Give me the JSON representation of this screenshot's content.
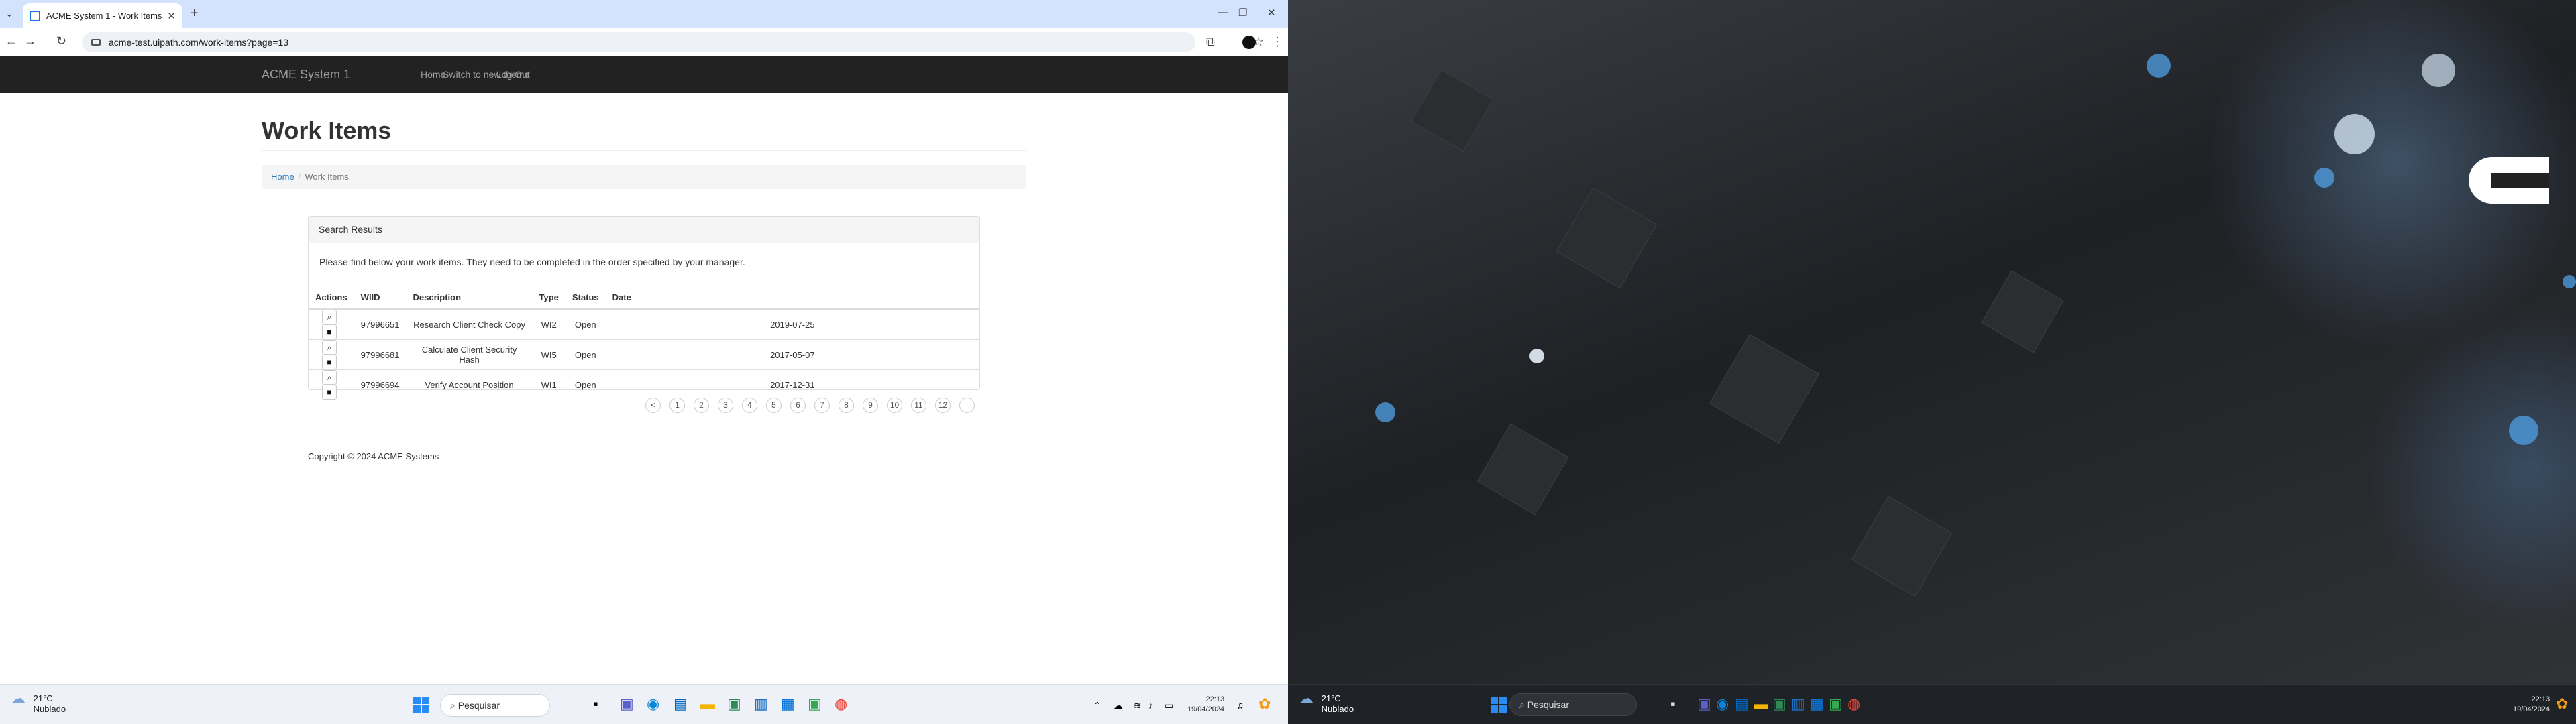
{
  "browser": {
    "tab_title": "ACME System 1 - Work Items",
    "url": "acme-test.uipath.com/work-items?page=13"
  },
  "app": {
    "brand": "ACME System 1",
    "nav": [
      "Home",
      "Switch to new theme",
      "Log Out"
    ]
  },
  "page": {
    "title": "Work Items",
    "breadcrumb": [
      "Home",
      "Work Items"
    ],
    "panel_title": "Search Results",
    "intro": "Please find below your work items. They need to be completed in the order specified by your manager.",
    "columns": [
      "Actions",
      "WIID",
      "Description",
      "Type",
      "Status",
      "Date"
    ],
    "rows": [
      {
        "wiid": "97996651",
        "description": "Research Client Check Copy",
        "type": "WI2",
        "status": "Open",
        "date": "2019-07-25"
      },
      {
        "wiid": "97996681",
        "description": "Calculate Client Security Hash",
        "type": "WI5",
        "status": "Open",
        "date": "2017-05-07"
      },
      {
        "wiid": "97996694",
        "description": "Verify Account Position",
        "type": "WI1",
        "status": "Open",
        "date": "2017-12-31"
      }
    ],
    "pagination": {
      "prev": "<",
      "pages": [
        "1",
        "2",
        "3",
        "4",
        "5",
        "6",
        "7",
        "8",
        "9",
        "10",
        "11",
        "12"
      ],
      "next": ""
    },
    "copyright": "Copyright © 2024 ACME Systems"
  },
  "taskbar_left": {
    "temp": "21°C",
    "weather": "Nublado",
    "search_placeholder": "Pesquisar",
    "time": "22:13",
    "date": "19/04/2024"
  },
  "taskbar_right": {
    "temp": "21°C",
    "weather": "Nublado",
    "search_placeholder": "Pesquisar",
    "time": "22:13",
    "date": "19/04/2024"
  }
}
